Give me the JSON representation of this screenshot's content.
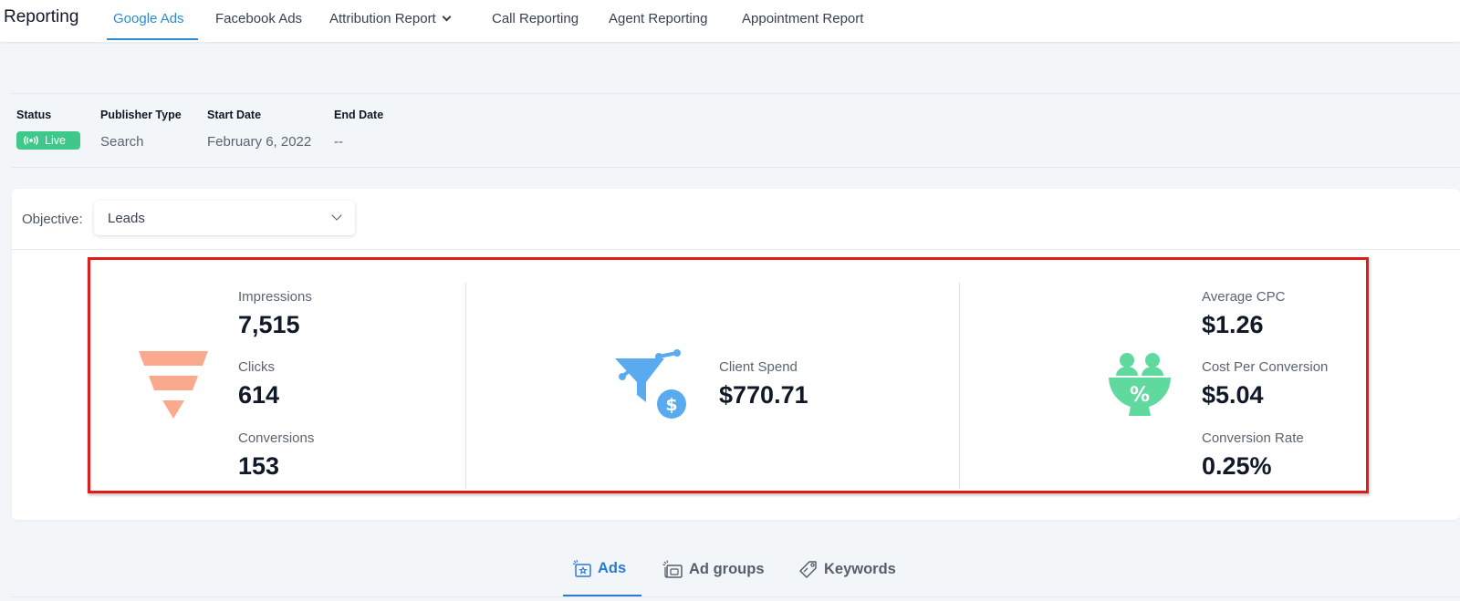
{
  "nav": {
    "brand": "Reporting",
    "tabs": [
      {
        "label": "Google Ads",
        "active": true
      },
      {
        "label": "Facebook Ads"
      },
      {
        "label": "Attribution Report",
        "has_dropdown": true
      },
      {
        "label": "Call Reporting"
      },
      {
        "label": "Agent Reporting"
      },
      {
        "label": "Appointment Report"
      }
    ]
  },
  "meta": {
    "status": {
      "label": "Status",
      "value": "Live"
    },
    "publisher_type": {
      "label": "Publisher Type",
      "value": "Search"
    },
    "start_date": {
      "label": "Start Date",
      "value": "February 6, 2022"
    },
    "end_date": {
      "label": "End Date",
      "value": "--"
    }
  },
  "objective": {
    "label": "Objective:",
    "value": "Leads"
  },
  "stats": {
    "impressions": {
      "label": "Impressions",
      "value": "7,515"
    },
    "clicks": {
      "label": "Clicks",
      "value": "614"
    },
    "conversions": {
      "label": "Conversions",
      "value": "153"
    },
    "client_spend": {
      "label": "Client Spend",
      "value": "$770.71"
    },
    "average_cpc": {
      "label": "Average CPC",
      "value": "$1.26"
    },
    "cost_per_conversion": {
      "label": "Cost Per Conversion",
      "value": "$5.04"
    },
    "conversion_rate": {
      "label": "Conversion Rate",
      "value": "0.25%"
    }
  },
  "bottom_tabs": [
    {
      "label": "Ads",
      "icon": "ad-icon",
      "active": true
    },
    {
      "label": "Ad groups",
      "icon": "ad-groups-icon"
    },
    {
      "label": "Keywords",
      "icon": "tag-icon"
    }
  ],
  "colors": {
    "accent": "#2a8bd0",
    "live": "#3ec98a",
    "funnel": "#fba98e",
    "spend_icon": "#5aaaf0",
    "bowl_icon": "#5fd99e",
    "highlight": "#e01b1b"
  }
}
